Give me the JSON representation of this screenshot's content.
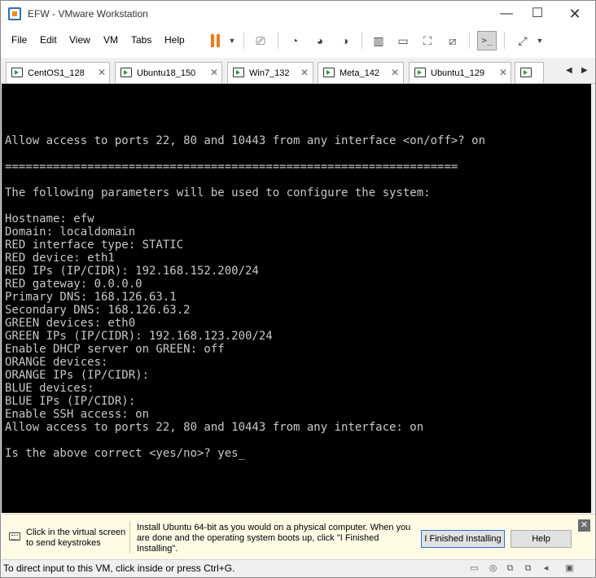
{
  "window": {
    "title": "EFW - VMware Workstation",
    "buttons": {
      "minimize": "—",
      "maximize": "☐",
      "close": "✕"
    }
  },
  "menu": {
    "file": "File",
    "edit": "Edit",
    "view": "View",
    "vm": "VM",
    "tabs": "Tabs",
    "help": "Help"
  },
  "tabs": [
    {
      "label": "CentOS1_128"
    },
    {
      "label": "Ubuntu18_150"
    },
    {
      "label": "Win7_132"
    },
    {
      "label": "Meta_142"
    },
    {
      "label": "Ubuntu1_129"
    }
  ],
  "console": {
    "lines": [
      "Allow access to ports 22, 80 and 10443 from any interface <on/off>? on",
      "",
      "==================================================================",
      "",
      "The following parameters will be used to configure the system:",
      "",
      "Hostname: efw",
      "Domain: localdomain",
      "RED interface type: STATIC",
      "RED device: eth1",
      "RED IPs (IP/CIDR): 192.168.152.200/24",
      "RED gateway: 0.0.0.0",
      "Primary DNS: 168.126.63.1",
      "Secondary DNS: 168.126.63.2",
      "GREEN devices: eth0",
      "GREEN IPs (IP/CIDR): 192.168.123.200/24",
      "Enable DHCP server on GREEN: off",
      "ORANGE devices:",
      "ORANGE IPs (IP/CIDR):",
      "BLUE devices:",
      "BLUE IPs (IP/CIDR):",
      "Enable SSH access: on",
      "Allow access to ports 22, 80 and 10443 from any interface: on",
      "",
      "Is the above correct <yes/no>? yes_"
    ]
  },
  "hint": {
    "click_text": "Click in the virtual screen to send keystrokes",
    "install_text": "Install Ubuntu 64-bit as you would on a physical computer. When you are done and the operating system boots up, click \"I Finished Installing\".",
    "finished_button": "I Finished Installing",
    "help_button": "Help"
  },
  "status": {
    "text": "To direct input to this VM, click inside or press Ctrl+G."
  },
  "colors": {
    "console_bg": "#000000",
    "console_fg": "#c8c8c8",
    "pause_accent": "#f07a1a",
    "hint_bg": "#fffbe5"
  }
}
